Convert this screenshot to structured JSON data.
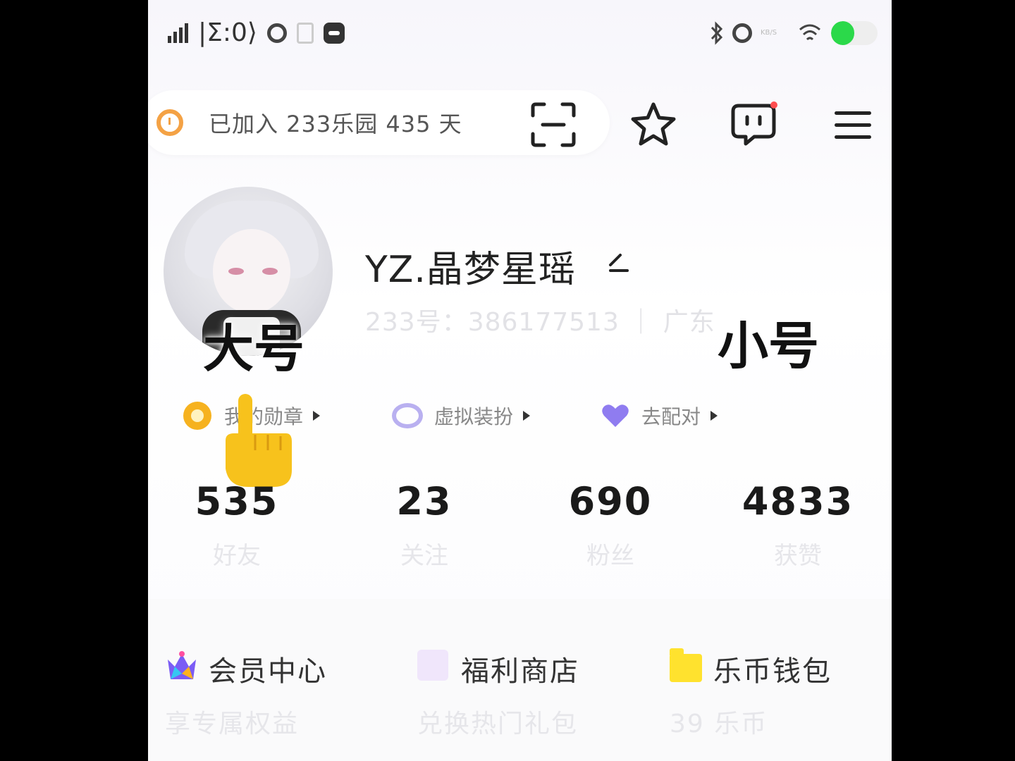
{
  "status_bar": {
    "left_text": "|Σ:0⟩",
    "speed": "KB/S"
  },
  "battery": {
    "level": 0.5
  },
  "header": {
    "join_text": "已加入 233乐园 435 天"
  },
  "icons": {
    "scan": "scan-icon",
    "star": "star-icon",
    "message": "message-icon",
    "menu": "menu-icon"
  },
  "profile": {
    "username": "YZ.晶梦星瑶",
    "sub_info": "233号：386177513 ｜ 广东"
  },
  "overlay": {
    "left": "大号",
    "right": "小号"
  },
  "chips": [
    {
      "label": "我的勋章"
    },
    {
      "label": "虚拟装扮"
    },
    {
      "label": "去配对"
    }
  ],
  "stats": [
    {
      "value": "535",
      "label": "好友"
    },
    {
      "value": "23",
      "label": "关注"
    },
    {
      "value": "690",
      "label": "粉丝"
    },
    {
      "value": "4833",
      "label": "获赞"
    }
  ],
  "cards": [
    {
      "title": "会员中心",
      "subtitle": "享专属权益"
    },
    {
      "title": "福利商店",
      "subtitle": "兑换热门礼包"
    },
    {
      "title": "乐币钱包",
      "subtitle": "39 乐币"
    }
  ],
  "colors": {
    "accent_battery": "#2bd94a",
    "badge": "#f6b21f",
    "notification_dot": "#ff4d4f"
  }
}
